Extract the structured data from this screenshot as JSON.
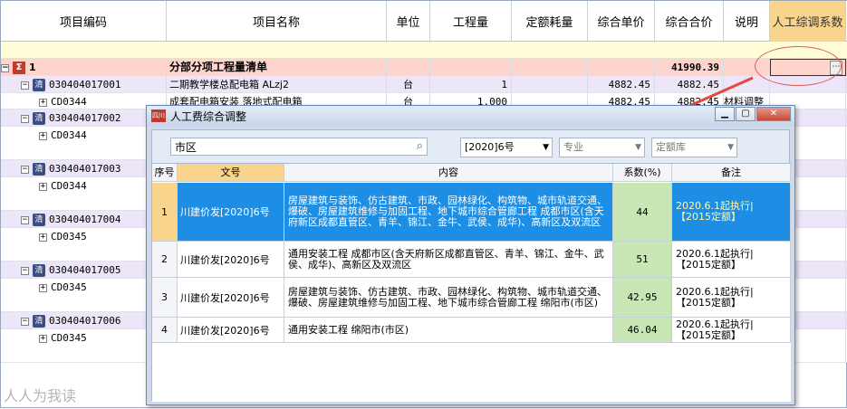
{
  "main": {
    "columns": [
      "项目编码",
      "项目名称",
      "单位",
      "工程量",
      "定额耗量",
      "综合单价",
      "综合合价",
      "说明",
      "人工综调系数"
    ],
    "summary": {
      "code": "1",
      "name": "分部分项工程量清单",
      "total": "41990.39"
    },
    "rows": [
      {
        "kind": "item",
        "code": "030404017001",
        "name": "二期教学楼总配电箱 ALzj2",
        "unit": "台",
        "qty": "1",
        "price": "4882.45",
        "total": "4882.45"
      },
      {
        "kind": "sub",
        "code": "CD0344",
        "name": "成套配电箱安装 落地式配电箱",
        "unit": "台",
        "qty": "1.000",
        "price": "4882.45",
        "total": "4882.45",
        "note": "材料调整"
      },
      {
        "kind": "item",
        "code": "030404017002"
      },
      {
        "kind": "sub",
        "code": "CD0344"
      },
      {
        "kind": "item",
        "code": "030404017003"
      },
      {
        "kind": "sub",
        "code": "CD0344"
      },
      {
        "kind": "item",
        "code": "030404017004"
      },
      {
        "kind": "sub",
        "code": "CD0345"
      },
      {
        "kind": "item",
        "code": "030404017005"
      },
      {
        "kind": "sub",
        "code": "CD0345"
      },
      {
        "kind": "item",
        "code": "030404017006"
      },
      {
        "kind": "sub",
        "code": "CD0345"
      }
    ]
  },
  "dialog": {
    "title": "人工费综合调整",
    "icon_text": "四川",
    "search_value": "市区",
    "filters": {
      "doc": "[2020]6号",
      "major": "专业",
      "library": "定额库"
    },
    "columns": [
      "序号",
      "文号",
      "内容",
      "系数(%)",
      "备注"
    ],
    "rows": [
      {
        "idx": "1",
        "doc": "川建价发[2020]6号",
        "content": "房屋建筑与装饰、仿古建筑、市政、园林绿化、构筑物、城市轨道交通、爆破、房屋建筑维修与加固工程、地下城市综合管廊工程 成都市区(含天府新区成都直管区、青羊、锦江、金牛、武侯、成华)、高新区及双流区",
        "coef": "44",
        "note": "2020.6.1起执行|【2015定额】"
      },
      {
        "idx": "2",
        "doc": "川建价发[2020]6号",
        "content": "通用安装工程 成都市区(含天府新区成都直管区、青羊、锦江、金牛、武侯、成华)、高新区及双流区",
        "coef": "51",
        "note": "2020.6.1起执行|【2015定额】"
      },
      {
        "idx": "3",
        "doc": "川建价发[2020]6号",
        "content": "房屋建筑与装饰、仿古建筑、市政、园林绿化、构筑物、城市轨道交通、爆破、房屋建筑维修与加固工程、地下城市综合管廊工程 绵阳市(市区)",
        "coef": "42.95",
        "note": "2020.6.1起执行|【2015定额】"
      },
      {
        "idx": "4",
        "doc": "川建价发[2020]6号",
        "content": "通用安装工程 绵阳市(市区)",
        "coef": "46.04",
        "note": "2020.6.1起执行|【2015定额】"
      }
    ]
  },
  "watermark": "人人为我读"
}
